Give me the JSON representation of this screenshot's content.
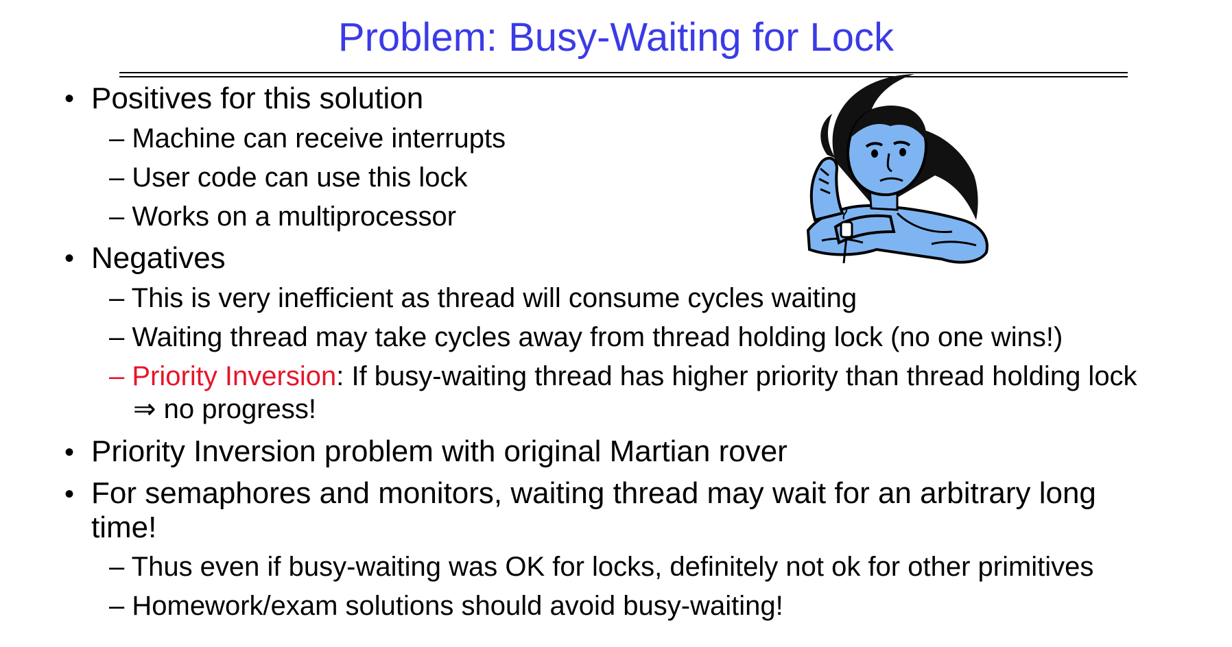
{
  "title": "Problem: Busy-Waiting for Lock",
  "bullet_char": "•",
  "positives": {
    "heading": "Positives for this solution",
    "items": [
      "– Machine can receive interrupts",
      "– User code can use this lock",
      "– Works on a multiprocessor"
    ]
  },
  "negatives": {
    "heading": "Negatives",
    "item1": "– This is very inefficient as thread will consume cycles waiting",
    "item2": "– Waiting thread may take cycles away from thread holding lock (no one wins!)",
    "item3_prefix": "– Priority Inversion",
    "item3_rest": ": If busy-waiting thread has higher priority than thread holding lock",
    "item3_cont": "⇒ no progress!"
  },
  "rover": "Priority Inversion problem with original Martian rover",
  "semaphores": {
    "line1": "For semaphores and monitors, waiting thread may wait for an arbitrary long",
    "line2": "time!",
    "items": [
      "– Thus even if busy-waiting was OK for locks, definitely not ok for other primitives",
      "– Homework/exam solutions should avoid busy-waiting!"
    ]
  },
  "colors": {
    "title": "#3b3be6",
    "highlight": "#e8142a",
    "figure": "#7fb4f2"
  }
}
